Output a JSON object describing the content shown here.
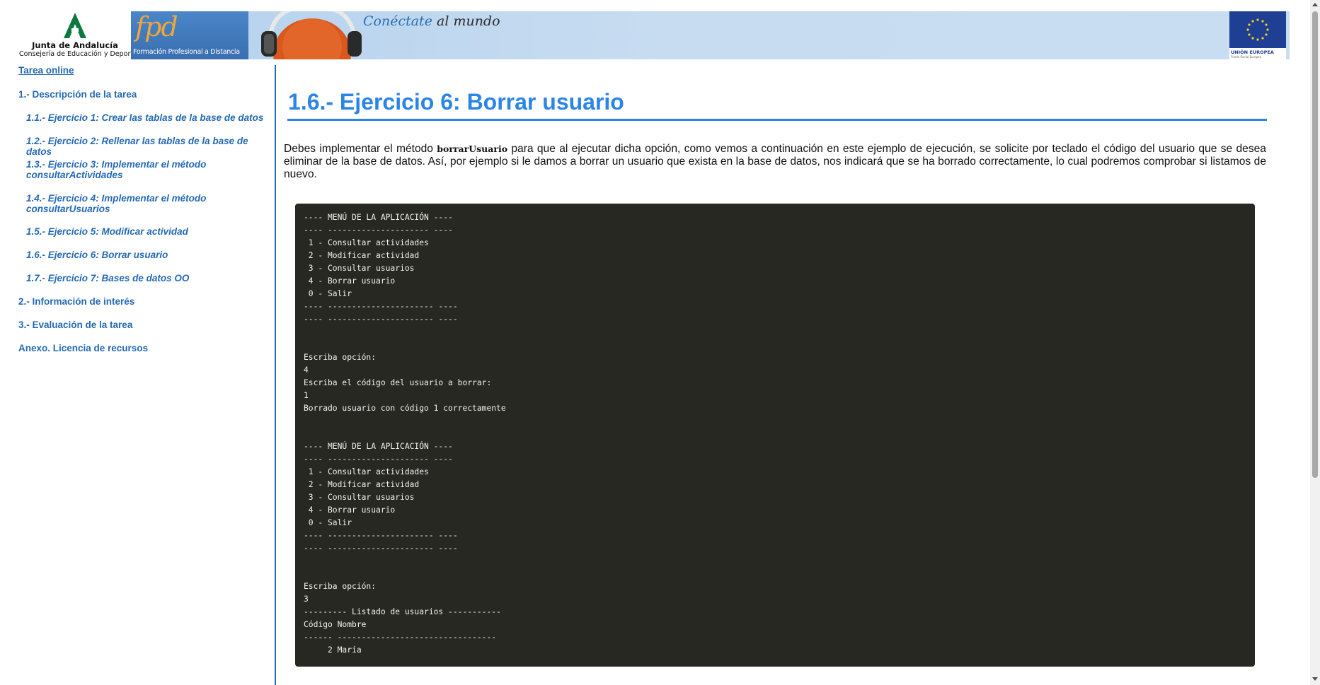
{
  "header": {
    "org_name": "Junta de Andalucía",
    "org_department": "Consejería de Educación y Deporte",
    "fpd_logo": "fpd",
    "fpd_caption": "Formación Profesional a Distancia",
    "slogan_prefix": "Conéctate",
    "slogan_suffix": "al mundo",
    "eu_label": "UNIÓN EUROPEA",
    "eu_sub": "Fondo Social Europeo",
    "colors": {
      "banner": "#c7dcf1",
      "fpd_blue": "#3a6fb0",
      "fpd_orange": "#f0a63a",
      "eu_blue": "#1f3f94",
      "junta_green": "#0c7a3e"
    }
  },
  "sidebar": {
    "top_link": "Tarea online",
    "items": [
      {
        "label": "1.- Descripción de la tarea",
        "level": 1
      },
      {
        "label": "1.1.- Ejercicio 1: Crear las tablas de la base de datos",
        "level": 2
      },
      {
        "label": "1.2.- Ejercicio 2: Rellenar las tablas de la base de datos",
        "level": 2
      },
      {
        "label": "1.3.- Ejercicio 3: Implementar el método consultarActividades",
        "level": 2
      },
      {
        "label": "1.4.- Ejercicio 4: Implementar el método consultarUsuarios",
        "level": 2
      },
      {
        "label": "1.5.- Ejercicio 5: Modificar actividad",
        "level": 2
      },
      {
        "label": "1.6.- Ejercicio 6: Borrar usuario",
        "level": 2
      },
      {
        "label": "1.7.- Ejercicio 7: Bases de datos OO",
        "level": 2
      },
      {
        "label": "2.- Información de interés",
        "level": 1
      },
      {
        "label": "3.- Evaluación de la tarea",
        "level": 1
      },
      {
        "label": "Anexo. Licencia de recursos",
        "level": 1
      }
    ],
    "link_color": "#2469b3"
  },
  "main": {
    "title": "1.6.- Ejercicio 6: Borrar usuario",
    "title_color": "#2b85e5",
    "intro_before": "Debes implementar el método ",
    "intro_code": "borrarUsuario",
    "intro_after": " para que al ejecutar dicha opción, como vemos a continuación en este ejemplo de ejecución, se solicite por teclado el código del usuario que se desea eliminar de la base de datos. Así, por ejemplo si le damos a borrar un usuario que exista en la base de datos, nos indicará que se ha borrado correctamente, lo cual podremos comprobar si listamos de nuevo.",
    "console_bg": "#272822",
    "console_lines": [
      "---- MENÚ DE LA APLICACIÓN ----",
      "---- --------------------- ----",
      " 1 - Consultar actividades",
      " 2 - Modificar actividad",
      " 3 - Consultar usuarios",
      " 4 - Borrar usuario",
      " 0 - Salir",
      "---- ---------------------- ----",
      "---- ---------------------- ----",
      "",
      "",
      "Escriba opción:",
      "4",
      "Escriba el código del usuario a borrar:",
      "1",
      "Borrado usuario con código 1 correctamente",
      "",
      "",
      "---- MENÚ DE LA APLICACIÓN ----",
      "---- --------------------- ----",
      " 1 - Consultar actividades",
      " 2 - Modificar actividad",
      " 3 - Consultar usuarios",
      " 4 - Borrar usuario",
      " 0 - Salir",
      "---- ---------------------- ----",
      "---- ---------------------- ----",
      "",
      "",
      "Escriba opción:",
      "3",
      "--------- Listado de usuarios -----------",
      "Código Nombre",
      "------ ---------------------------------",
      "     2 María"
    ]
  }
}
